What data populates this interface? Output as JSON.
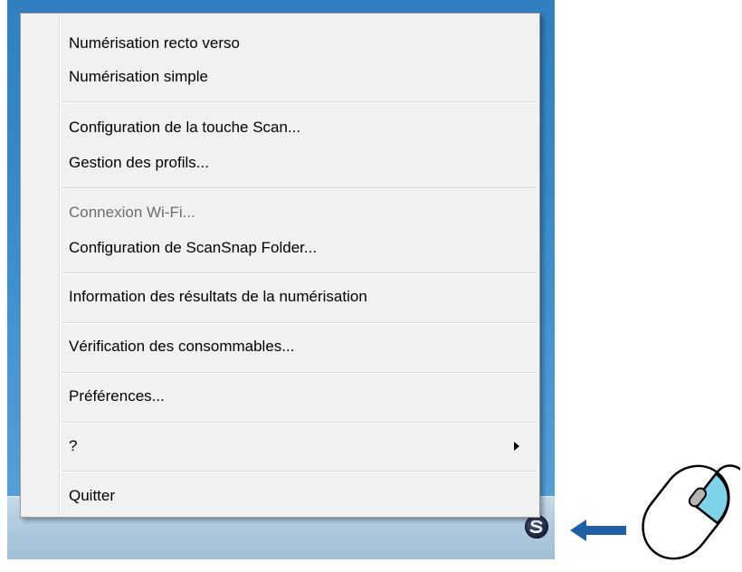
{
  "menu": {
    "items": [
      {
        "label": "Numérisation recto verso",
        "enabled": true
      },
      {
        "label": "Numérisation simple",
        "enabled": true
      },
      {
        "label": "Configuration de la touche Scan...",
        "enabled": true
      },
      {
        "label": "Gestion des profils...",
        "enabled": true
      },
      {
        "label": "Connexion Wi-Fi...",
        "enabled": false
      },
      {
        "label": "Configuration de ScanSnap Folder...",
        "enabled": true
      },
      {
        "label": "Information des résultats de la numérisation",
        "enabled": true
      },
      {
        "label": "Vérification des consommables...",
        "enabled": true
      },
      {
        "label": "Préférences...",
        "enabled": true
      },
      {
        "label": "?",
        "enabled": true,
        "has_submenu": true
      },
      {
        "label": "Quitter",
        "enabled": true
      }
    ]
  },
  "taskbar": {
    "tray_icon": "scansnap-manager-icon"
  },
  "illustration": {
    "arrow_icon": "left-arrow-icon",
    "arrow_color": "#1f5fa8",
    "mouse_icon": "mouse-right-click-icon",
    "mouse_button_highlight": "#7fd3e8"
  },
  "colors": {
    "desktop": "#3a8ccc",
    "menu_background": "#f1f1f1",
    "disabled_text": "#6d6d6d"
  }
}
